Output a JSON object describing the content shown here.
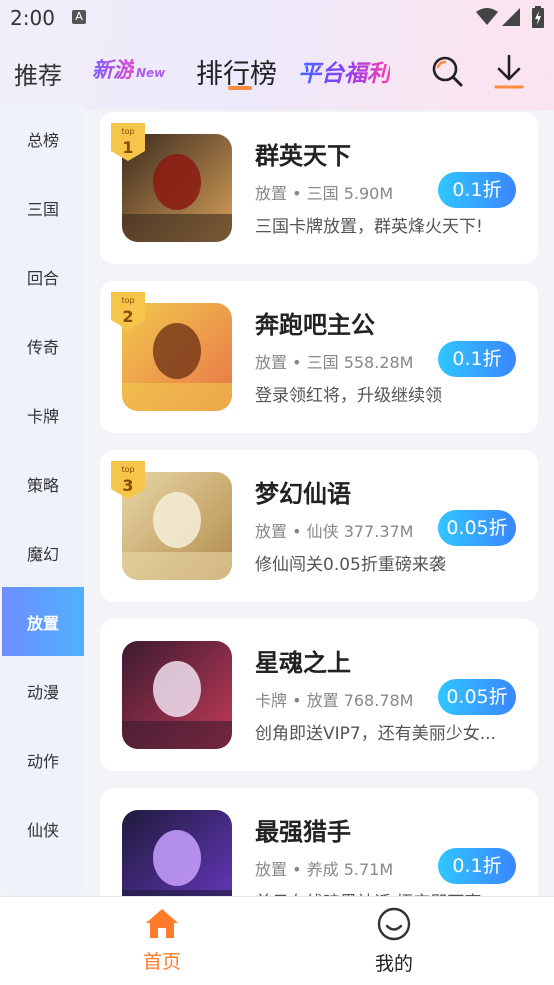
{
  "status_bar": {
    "time": "2:00",
    "notification_icon": "a-icon"
  },
  "nav": {
    "recommend": "推荐",
    "new_games": "新游",
    "new_games_tag": "New",
    "ranking": "排行榜",
    "welfare": "平台福利",
    "search_icon": "search-icon",
    "download_icon": "download-icon",
    "accent": "#ff8a3d"
  },
  "sidebar": {
    "items": [
      {
        "label": "总榜"
      },
      {
        "label": "三国"
      },
      {
        "label": "回合"
      },
      {
        "label": "传奇"
      },
      {
        "label": "卡牌"
      },
      {
        "label": "策略"
      },
      {
        "label": "魔幻"
      },
      {
        "label": "放置",
        "active": true
      },
      {
        "label": "动漫"
      },
      {
        "label": "动作"
      },
      {
        "label": "仙侠"
      }
    ]
  },
  "games": [
    {
      "name": "群英天下",
      "tags": "放置 • 三国 5.90M",
      "desc": "三国卡牌放置，群英烽火天下!",
      "discount": "0.1折",
      "rank": "1"
    },
    {
      "name": "奔跑吧主公",
      "tags": "放置 • 三国 558.28M",
      "desc": "登录领红将，升级继续领",
      "discount": "0.1折",
      "rank": "2"
    },
    {
      "name": "梦幻仙语",
      "tags": "放置 • 仙侠 377.37M",
      "desc": "修仙闯关0.05折重磅来袭",
      "discount": "0.05折",
      "rank": "3"
    },
    {
      "name": "星魂之上",
      "tags": "卡牌 • 放置 768.78M",
      "desc": "创角即送VIP7，还有美丽少女...",
      "discount": "0.05折",
      "rank": ""
    },
    {
      "name": "最强猎手",
      "tags": "放置 • 养成 5.71M",
      "desc": "首日在线暗黑神话 悟空即可享",
      "discount": "0.1折",
      "rank": ""
    }
  ],
  "rank_badge_text": "top",
  "bottom_nav": {
    "home": "首页",
    "mine": "我的",
    "home_color": "#ff7a2a"
  }
}
